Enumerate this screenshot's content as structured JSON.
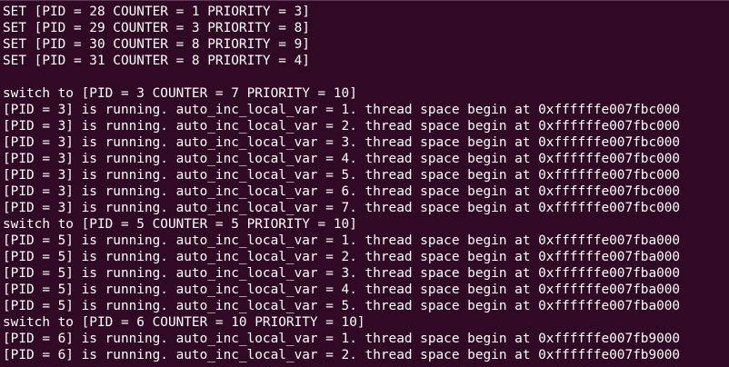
{
  "terminal": {
    "lines": [
      "SET [PID = 28 COUNTER = 1 PRIORITY = 3]",
      "SET [PID = 29 COUNTER = 3 PRIORITY = 8]",
      "SET [PID = 30 COUNTER = 8 PRIORITY = 9]",
      "SET [PID = 31 COUNTER = 8 PRIORITY = 4]",
      "",
      "switch to [PID = 3 COUNTER = 7 PRIORITY = 10]",
      "[PID = 3] is running. auto_inc_local_var = 1. thread space begin at 0xffffffe007fbc000",
      "[PID = 3] is running. auto_inc_local_var = 2. thread space begin at 0xffffffe007fbc000",
      "[PID = 3] is running. auto_inc_local_var = 3. thread space begin at 0xffffffe007fbc000",
      "[PID = 3] is running. auto_inc_local_var = 4. thread space begin at 0xffffffe007fbc000",
      "[PID = 3] is running. auto_inc_local_var = 5. thread space begin at 0xffffffe007fbc000",
      "[PID = 3] is running. auto_inc_local_var = 6. thread space begin at 0xffffffe007fbc000",
      "[PID = 3] is running. auto_inc_local_var = 7. thread space begin at 0xffffffe007fbc000",
      "switch to [PID = 5 COUNTER = 5 PRIORITY = 10]",
      "[PID = 5] is running. auto_inc_local_var = 1. thread space begin at 0xffffffe007fba000",
      "[PID = 5] is running. auto_inc_local_var = 2. thread space begin at 0xffffffe007fba000",
      "[PID = 5] is running. auto_inc_local_var = 3. thread space begin at 0xffffffe007fba000",
      "[PID = 5] is running. auto_inc_local_var = 4. thread space begin at 0xffffffe007fba000",
      "[PID = 5] is running. auto_inc_local_var = 5. thread space begin at 0xffffffe007fba000",
      "switch to [PID = 6 COUNTER = 10 PRIORITY = 10]",
      "[PID = 6] is running. auto_inc_local_var = 1. thread space begin at 0xffffffe007fb9000",
      "[PID = 6] is running. auto_inc_local_var = 2. thread space begin at 0xffffffe007fb9000"
    ]
  }
}
